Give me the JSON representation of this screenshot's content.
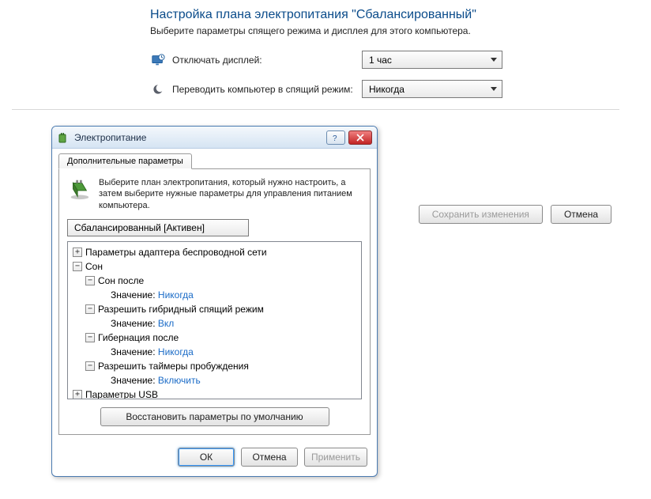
{
  "page": {
    "title": "Настройка плана электропитания \"Сбалансированный\"",
    "subtitle": "Выберите параметры спящего режима и дисплея для этого компьютера.",
    "rows": [
      {
        "label": "Отключать дисплей:",
        "value": "1 час"
      },
      {
        "label": "Переводить компьютер в спящий режим:",
        "value": "Никогда"
      }
    ],
    "save_btn": "Сохранить изменения",
    "cancel_btn": "Отмена"
  },
  "dialog": {
    "title": "Электропитание",
    "tab": "Дополнительные параметры",
    "description": "Выберите план электропитания, который нужно настроить, а затем выберите нужные параметры для управления питанием компьютера.",
    "plan_dropdown": "Сбалансированный [Активен]",
    "tree": {
      "wireless": "Параметры адаптера беспроводной сети",
      "sleep": "Сон",
      "sleep_after": "Сон после",
      "value_label": "Значение:",
      "sleep_after_val": "Никогда",
      "hybrid": "Разрешить гибридный спящий режим",
      "hybrid_val": "Вкл",
      "hibernate": "Гибернация после",
      "hibernate_val": "Никогда",
      "wake_timers": "Разрешить таймеры пробуждения",
      "wake_timers_val": "Включить",
      "usb": "Параметры USB"
    },
    "restore_defaults": "Восстановить параметры по умолчанию",
    "ok": "ОК",
    "cancel": "Отмена",
    "apply": "Применить"
  }
}
